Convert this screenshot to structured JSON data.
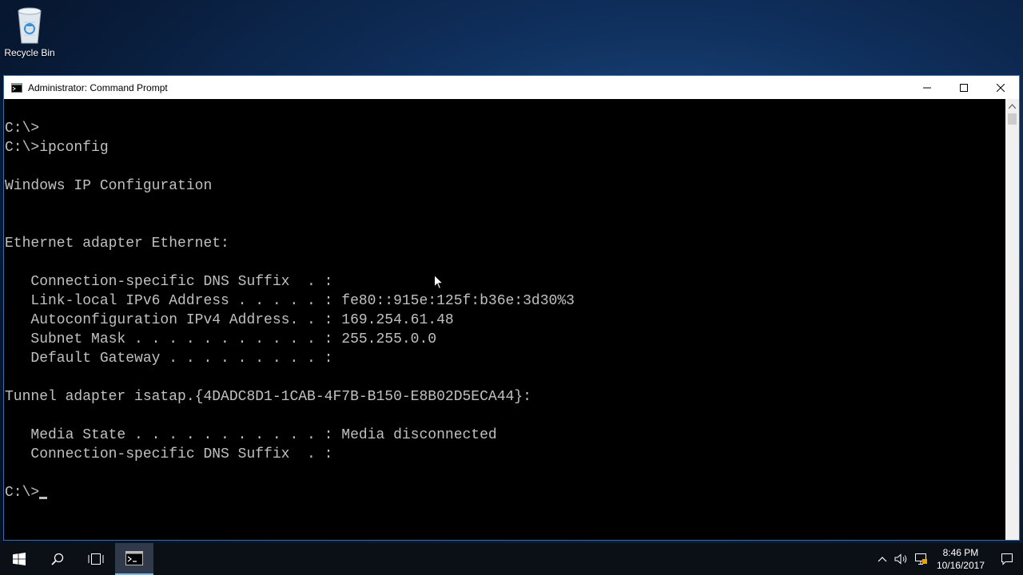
{
  "desktop": {
    "recycle_bin_label": "Recycle Bin"
  },
  "window": {
    "title": "Administrator: Command Prompt",
    "icons": {
      "app": "cmd-icon",
      "minimize": "minimize-icon",
      "maximize": "maximize-icon",
      "close": "close-icon"
    }
  },
  "console": {
    "lines": [
      "C:\\>",
      "C:\\>ipconfig",
      "",
      "Windows IP Configuration",
      "",
      "",
      "Ethernet adapter Ethernet:",
      "",
      "   Connection-specific DNS Suffix  . :",
      "   Link-local IPv6 Address . . . . . : fe80::915e:125f:b36e:3d30%3",
      "   Autoconfiguration IPv4 Address. . : 169.254.61.48",
      "   Subnet Mask . . . . . . . . . . . : 255.255.0.0",
      "   Default Gateway . . . . . . . . . :",
      "",
      "Tunnel adapter isatap.{4DADC8D1-1CAB-4F7B-B150-E8B02D5ECA44}:",
      "",
      "   Media State . . . . . . . . . . . : Media disconnected",
      "   Connection-specific DNS Suffix  . :",
      "",
      "C:\\>"
    ],
    "foreground": "#c0c0c0",
    "background": "#000000"
  },
  "taskbar": {
    "clock_time": "8:46 PM",
    "clock_date": "10/16/2017",
    "icons": [
      "windows-start-icon",
      "search-icon",
      "task-view-icon",
      "cmd-taskbar-icon"
    ],
    "tray_icons": [
      "chevron-up-icon",
      "volume-icon",
      "network-icon",
      "notification-icon"
    ]
  }
}
